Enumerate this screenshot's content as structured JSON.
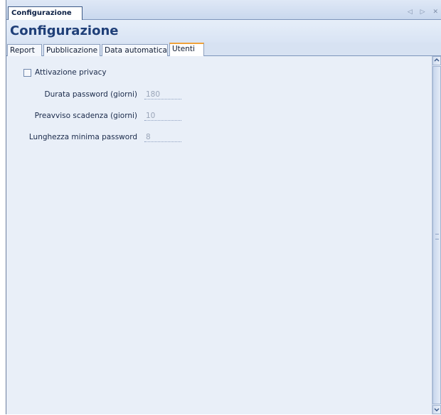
{
  "window": {
    "doc_tab_label": "Configurazione",
    "nav_arrows": "◁ ▷ ✕"
  },
  "page": {
    "title": "Configurazione"
  },
  "tabs": [
    {
      "label": "Report"
    },
    {
      "label": "Pubblicazione"
    },
    {
      "label": "Data automatica"
    },
    {
      "label": "Utenti"
    }
  ],
  "active_tab": "Utenti",
  "privacy": {
    "label": "Attivazione privacy",
    "checked": false
  },
  "fields": [
    {
      "label": "Durata password (giorni)",
      "value": "180"
    },
    {
      "label": "Preavviso scadenza (giorni)",
      "value": "10"
    },
    {
      "label": "Lunghezza minima password",
      "value": "8"
    }
  ],
  "scrollbar": {
    "up_icon": "chevron-up-icon",
    "down_icon": "chevron-down-icon"
  }
}
